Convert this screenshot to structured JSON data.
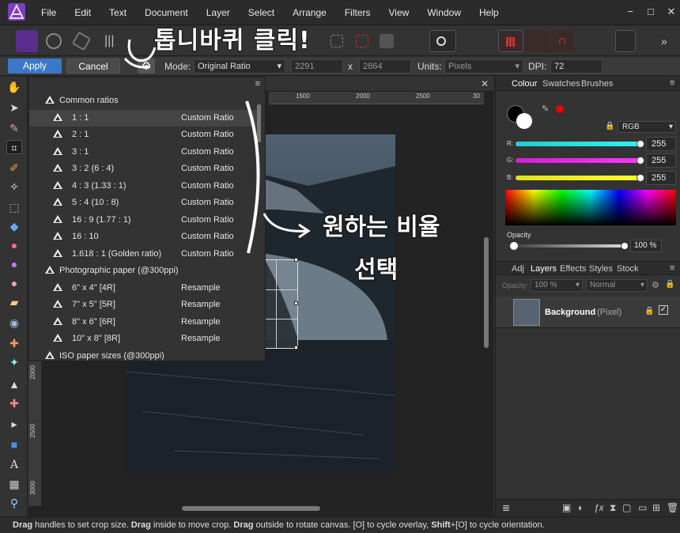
{
  "menu": [
    "File",
    "Edit",
    "Text",
    "Document",
    "Layer",
    "Select",
    "Arrange",
    "Filters",
    "View",
    "Window",
    "Help"
  ],
  "window_controls": [
    "−",
    "□",
    "✕"
  ],
  "context": {
    "apply": "Apply",
    "cancel": "Cancel",
    "mode_label": "Mode:",
    "mode_value": "Original Ratio",
    "width": "2291",
    "x": "x",
    "height": "2864",
    "units_label": "Units:",
    "units_value": "Pixels",
    "dpi_label": "DPI:",
    "dpi_value": "72"
  },
  "ruler": {
    "h": [
      "1500",
      "2000",
      "2500",
      "30"
    ],
    "v": [
      "2000",
      "2500",
      "3000"
    ]
  },
  "presets": [
    {
      "kind": "cat",
      "name": "Common ratios",
      "type": ""
    },
    {
      "kind": "item",
      "name": "1 : 1",
      "type": "Custom Ratio"
    },
    {
      "kind": "item",
      "name": "2 : 1",
      "type": "Custom Ratio"
    },
    {
      "kind": "item",
      "name": "3 : 1",
      "type": "Custom Ratio"
    },
    {
      "kind": "item",
      "name": "3 : 2  (6 : 4)",
      "type": "Custom Ratio"
    },
    {
      "kind": "item",
      "name": "4 : 3  (1.33 : 1)",
      "type": "Custom Ratio"
    },
    {
      "kind": "item",
      "name": "5 : 4  (10 : 8)",
      "type": "Custom Ratio"
    },
    {
      "kind": "item",
      "name": "16 : 9  (1.77 : 1)",
      "type": "Custom Ratio"
    },
    {
      "kind": "item",
      "name": "16 : 10",
      "type": "Custom Ratio"
    },
    {
      "kind": "item",
      "name": "1.618 : 1  (Golden ratio)",
      "type": "Custom Ratio"
    },
    {
      "kind": "cat",
      "name": "Photographic paper (@300ppi)",
      "type": ""
    },
    {
      "kind": "item",
      "name": "6\" x 4\"  [4R]",
      "type": "Resample"
    },
    {
      "kind": "item",
      "name": "7\" x 5\"  [5R]",
      "type": "Resample"
    },
    {
      "kind": "item",
      "name": "8\" x 6\"  [6R]",
      "type": "Resample"
    },
    {
      "kind": "item",
      "name": "10\" x 8\"  [8R]",
      "type": "Resample"
    },
    {
      "kind": "cat",
      "name": "ISO paper sizes (@300ppi)",
      "type": ""
    }
  ],
  "colour_panel": {
    "tabs": [
      "Colour",
      "Swatches",
      "Brushes"
    ],
    "model": "RGB",
    "r_label": "R:",
    "r": "255",
    "g_label": "G:",
    "g": "255",
    "b_label": "B:",
    "b": "255",
    "opacity_label": "Opacity",
    "opacity": "100 %"
  },
  "layers_panel": {
    "tabs": [
      "Adj",
      "Layers",
      "Effects",
      "Styles",
      "Stock"
    ],
    "opacity_label": "Opacity:",
    "opacity": "100 %",
    "blend": "Normal",
    "layer_name": "Background",
    "layer_type": "(Pixel)"
  },
  "annotations": {
    "top": "톱니바퀴 클릭!",
    "mid1": "원하는 비율",
    "mid2": "선택"
  },
  "status": {
    "b1": "Drag",
    "t1": " handles to set crop size. ",
    "b2": "Drag",
    "t2": " inside to move crop. ",
    "b3": "Drag",
    "t3": " outside to rotate canvas. [O] to cycle overlay, ",
    "b4": "Shift",
    "t4": "+[O] to cycle orientation."
  },
  "colors": {
    "accent": "#3a78c8",
    "slider_r": "#2ef2f2",
    "slider_g": "#ff33ff",
    "slider_b": "#ffff2a",
    "fg_swatch": "#000000",
    "bg_swatch": "#ffffff"
  }
}
